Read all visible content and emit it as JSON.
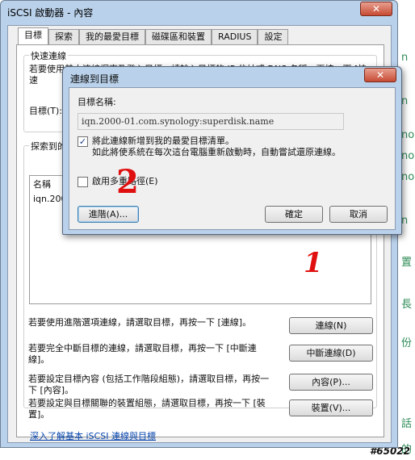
{
  "background": {
    "side_glyphs": [
      "n",
      "n",
      "no",
      "no",
      "no",
      "n",
      "置",
      "長",
      "份",
      "話",
      "的"
    ],
    "watermark": "#65022"
  },
  "main_window": {
    "title": "iSCSI 啟動器 - 內容",
    "close_label": "✕",
    "tabs": [
      "目標",
      "探索",
      "我的最愛目標",
      "磁碟區和裝置",
      "RADIUS",
      "設定"
    ],
    "quick_connect": {
      "group_label": "快速連線",
      "description": "若要使用基本連線探索及登入目標，請輸入目標的 IP 位址或 DNS 名稱，再按一下 [快速",
      "target_label": "目標(T):"
    },
    "discovered": {
      "group_label": "探索到的",
      "column_name": "名稱",
      "row_name": "iqn.2000"
    },
    "actions": [
      {
        "text": "若要使用進階選項連線，請選取目標，再按一下 [連線]。",
        "button": "連線(N)"
      },
      {
        "text": "若要完全中斷目標的連線，請選取目標，再按一下 [中斷連線]。",
        "button": "中斷連線(D)"
      },
      {
        "text": "若要設定目標內容 (包括工作階段組態)，請選取目標，再按一下 [內容]。",
        "button": "內容(P)..."
      },
      {
        "text": "若要設定與目標關聯的裝置組態，請選取目標，再按一下 [裝置]。",
        "button": "裝置(V)..."
      }
    ],
    "learn_more_link": "深入了解基本 iSCSI 連線與目標"
  },
  "dialog": {
    "title": "連線到目標",
    "close_label": "✕",
    "target_name_label": "目標名稱:",
    "target_name_value": "iqn.2000-01.com.synology:superdisk.name",
    "add_favorite_label": "將此連線新增到我的最愛目標清單。",
    "add_favorite_checked": true,
    "add_favorite_desc": "如此將使系統在每次這台電腦重新啟動時，自動嘗試還原連線。",
    "multipath_label": "啟用多重路徑(E)",
    "multipath_checked": false,
    "advanced_button": "進階(A)...",
    "ok_button": "確定",
    "cancel_button": "取消"
  },
  "annotations": {
    "mark_1": "1",
    "mark_2": "2"
  },
  "colors": {
    "window_frame": "#b9d1ea",
    "link": "#0645ad",
    "annotation": "#e01010",
    "close_red": "#c74a34"
  }
}
